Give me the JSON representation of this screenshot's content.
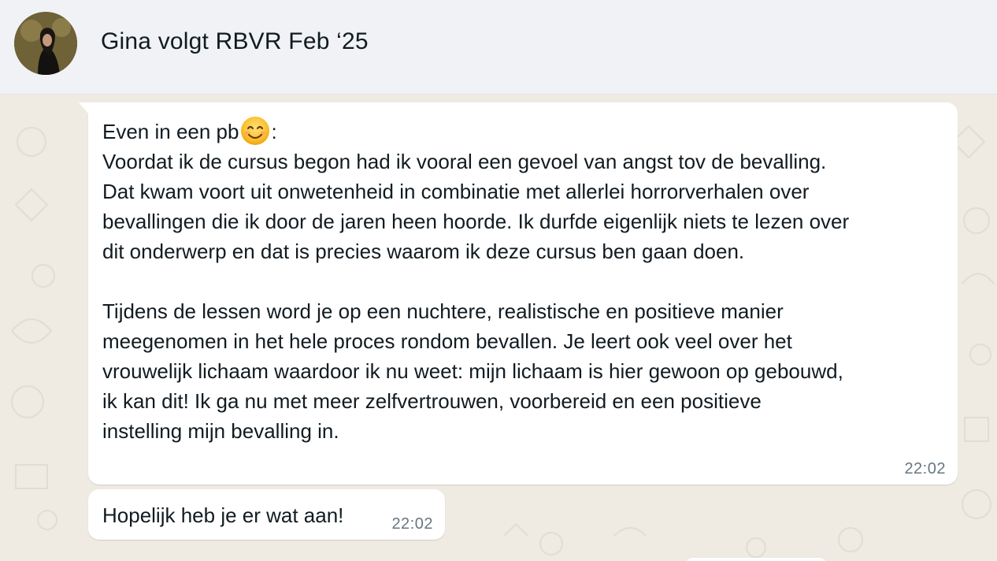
{
  "header": {
    "title": "Gina volgt RBVR Feb ‘25",
    "avatar_icon": "profile-photo"
  },
  "messages": [
    {
      "intro": "Even in een pb",
      "emoji_name": "smiling-face-emoji",
      "intro_suffix": ":",
      "body": "\nVoordat ik de cursus begon had ik vooral een gevoel van angst tov de bevalling.\nDat kwam voort uit onwetenheid in combinatie met allerlei horrorverhalen over\nbevallingen die ik door de jaren heen hoorde. Ik durfde eigenlijk niets te lezen over\ndit onderwerp en dat is precies waarom ik deze cursus ben gaan doen.\n\nTijdens de lessen word je op een nuchtere, realistische en positieve manier\nmeegenomen in het hele proces rondom bevallen. Je leert ook veel over het\nvrouwelijk lichaam waardoor ik nu weet: mijn lichaam is hier gewoon op gebouwd,\nik kan dit! Ik ga nu met meer zelfvertrouwen, voorbereid  en een positieve\ninstelling mijn bevalling in.",
      "time": "22:02"
    },
    {
      "text": "Hopelijk heb je er wat aan!",
      "time": "22:02"
    }
  ],
  "colors": {
    "header_bg": "#f0f2f5",
    "chat_bg": "#efeae2",
    "bubble_bg": "#ffffff",
    "text": "#111b21",
    "timestamp": "#667781"
  }
}
